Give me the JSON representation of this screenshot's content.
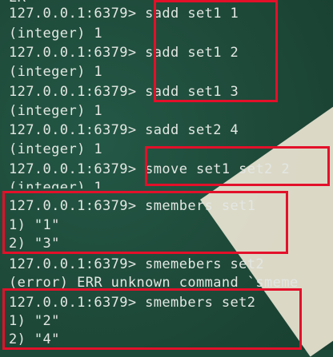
{
  "terminal": {
    "lines": [
      "ER",
      "127.0.0.1:6379> sadd set1 1",
      "(integer) 1",
      "127.0.0.1:6379> sadd set1 2",
      "(integer) 1",
      "127.0.0.1:6379> sadd set1 3",
      "(integer) 1",
      "127.0.0.1:6379> sadd set2 4",
      "(integer) 1",
      "127.0.0.1:6379> smove set1 set2 2",
      "(integer) 1",
      "127.0.0.1:6379> smembers set1",
      "1) \"1\"",
      "2) \"3\"",
      "127.0.0.1:6379> smemebers set2",
      "(error) ERR unknown command `smeme",
      "127.0.0.1:6379> smembers set2",
      "1) \"2\"",
      "2) \"4\""
    ]
  },
  "colors": {
    "background": "#1e4a3a",
    "text": "#e3e7e3",
    "highlight_box": "#e3102a",
    "paper": "#e6e0cf"
  }
}
